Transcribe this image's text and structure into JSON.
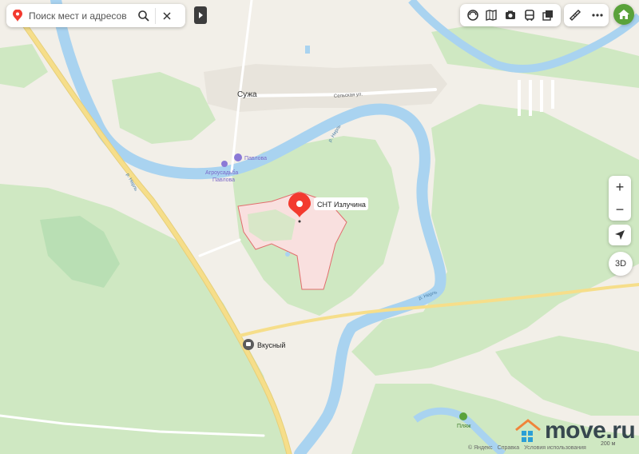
{
  "search": {
    "placeholder": "Поиск мест и адресов"
  },
  "icons": {
    "search": "magnifier-icon",
    "clear": "close-icon",
    "collapse": "chevron-right-icon",
    "layers": [
      "panorama-icon",
      "photo-icon",
      "camera-icon",
      "transit-icon",
      "layers-icon"
    ],
    "ruler": "ruler-icon",
    "more": "more-icon"
  },
  "map": {
    "labels": {
      "village": "Сужа",
      "street": "Сельская ул.",
      "river1": "р. Нерль",
      "river2": "р. Нерль",
      "river3": "р. Нерль",
      "pavlova": "Павлова",
      "agro_line1": "Агроусадьба",
      "agro_line2": "Павлова",
      "marker": "СНТ Излучина",
      "cafe": "Вкусный",
      "beach": "Пляж"
    },
    "colors": {
      "water": "#a9d3f0",
      "forest": "#cfe8c2",
      "road": "#f6de8a",
      "marker": "#f33a2f",
      "plot": "#f9e0df"
    }
  },
  "controls": {
    "zoom_in": "+",
    "zoom_out": "−",
    "threeD": "3D"
  },
  "footer": {
    "copyright": "© Яндекс",
    "help": "Справка",
    "terms": "Условия использования",
    "scale": "200 м"
  },
  "watermark": {
    "brand": "move.ru"
  }
}
